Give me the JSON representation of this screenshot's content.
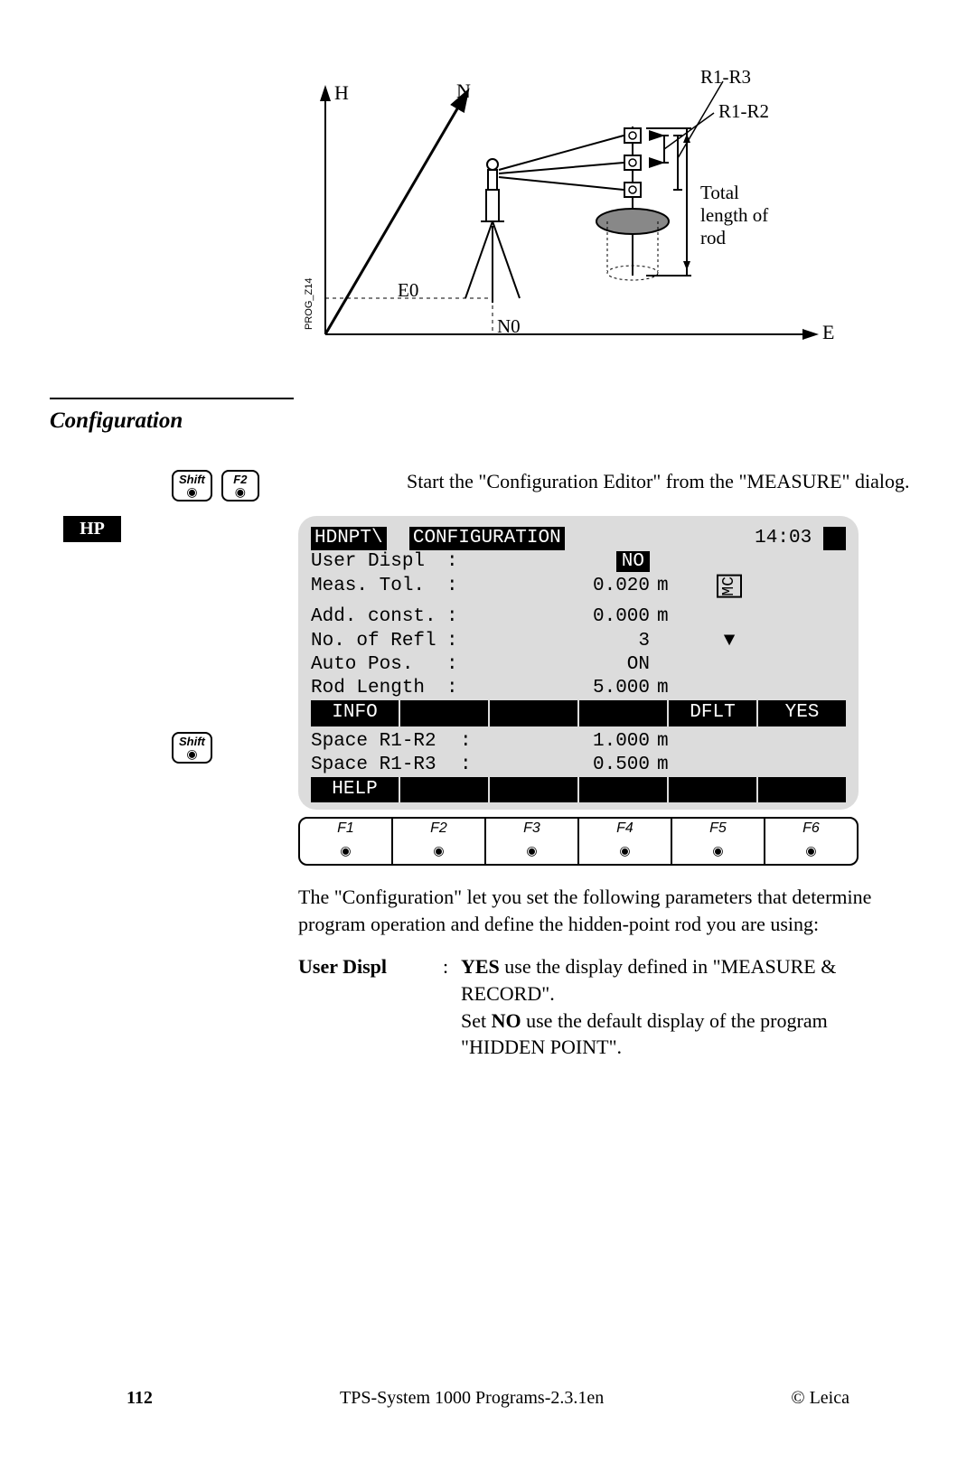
{
  "diagram": {
    "labels": {
      "H": "H",
      "N": "N",
      "E": "E",
      "E0": "E0",
      "N0": "N0",
      "R1R3": "R1-R3",
      "R1R2": "R1-R2",
      "total": "Total length of rod",
      "ref": "PROG_Z14"
    }
  },
  "section_title": "Configuration",
  "keys": {
    "shift": "Shift",
    "f2": "F2"
  },
  "sidebar_tab": "HP",
  "intro_text": "Start the \"Configuration Editor\" from the \"MEASURE\" dialog.",
  "screen": {
    "title_left": "HDNPT\\",
    "title_mid": "CONFIGURATION",
    "title_right": "14:03",
    "battery_icon": "■",
    "side_label": "MC",
    "rows": [
      {
        "label": "User Displ",
        "value": "NO",
        "unit": "",
        "inv": true
      },
      {
        "label": "Meas. Tol.",
        "value": "0.020",
        "unit": "m"
      },
      {
        "label": "Add. const.",
        "value": "0.000",
        "unit": "m"
      },
      {
        "label": "No. of Refl",
        "value": "3",
        "unit": "",
        "dropdown": true
      },
      {
        "label": "Auto Pos.",
        "value": "ON",
        "unit": ""
      },
      {
        "label": "Rod Length",
        "value": "5.000",
        "unit": "m"
      }
    ],
    "fbar1": [
      "INFO",
      "",
      "",
      "",
      "DFLT",
      "YES"
    ],
    "rows2": [
      {
        "label": "Space R1-R2",
        "value": "1.000",
        "unit": "m"
      },
      {
        "label": "Space R1-R3",
        "value": "0.500",
        "unit": "m"
      }
    ],
    "fbar2": [
      "HELP",
      "",
      "",
      "",
      "",
      ""
    ],
    "fkeys": [
      "F1",
      "F2",
      "F3",
      "F4",
      "F5",
      "F6"
    ]
  },
  "after_text": "The \"Configuration\" let you set the following parameters that determine program operation and define the hidden-point rod you are using:",
  "definition": {
    "term": "User Displ",
    "yes": "YES",
    "yes_text": " use the display defined in \"MEASURE & RECORD\".",
    "no_prefix": "Set ",
    "no": "NO",
    "no_text": " use the default display of the program \"HIDDEN POINT\"."
  },
  "footer": {
    "page": "112",
    "center": "TPS-System 1000 Programs-2.3.1en",
    "right": "© Leica"
  }
}
